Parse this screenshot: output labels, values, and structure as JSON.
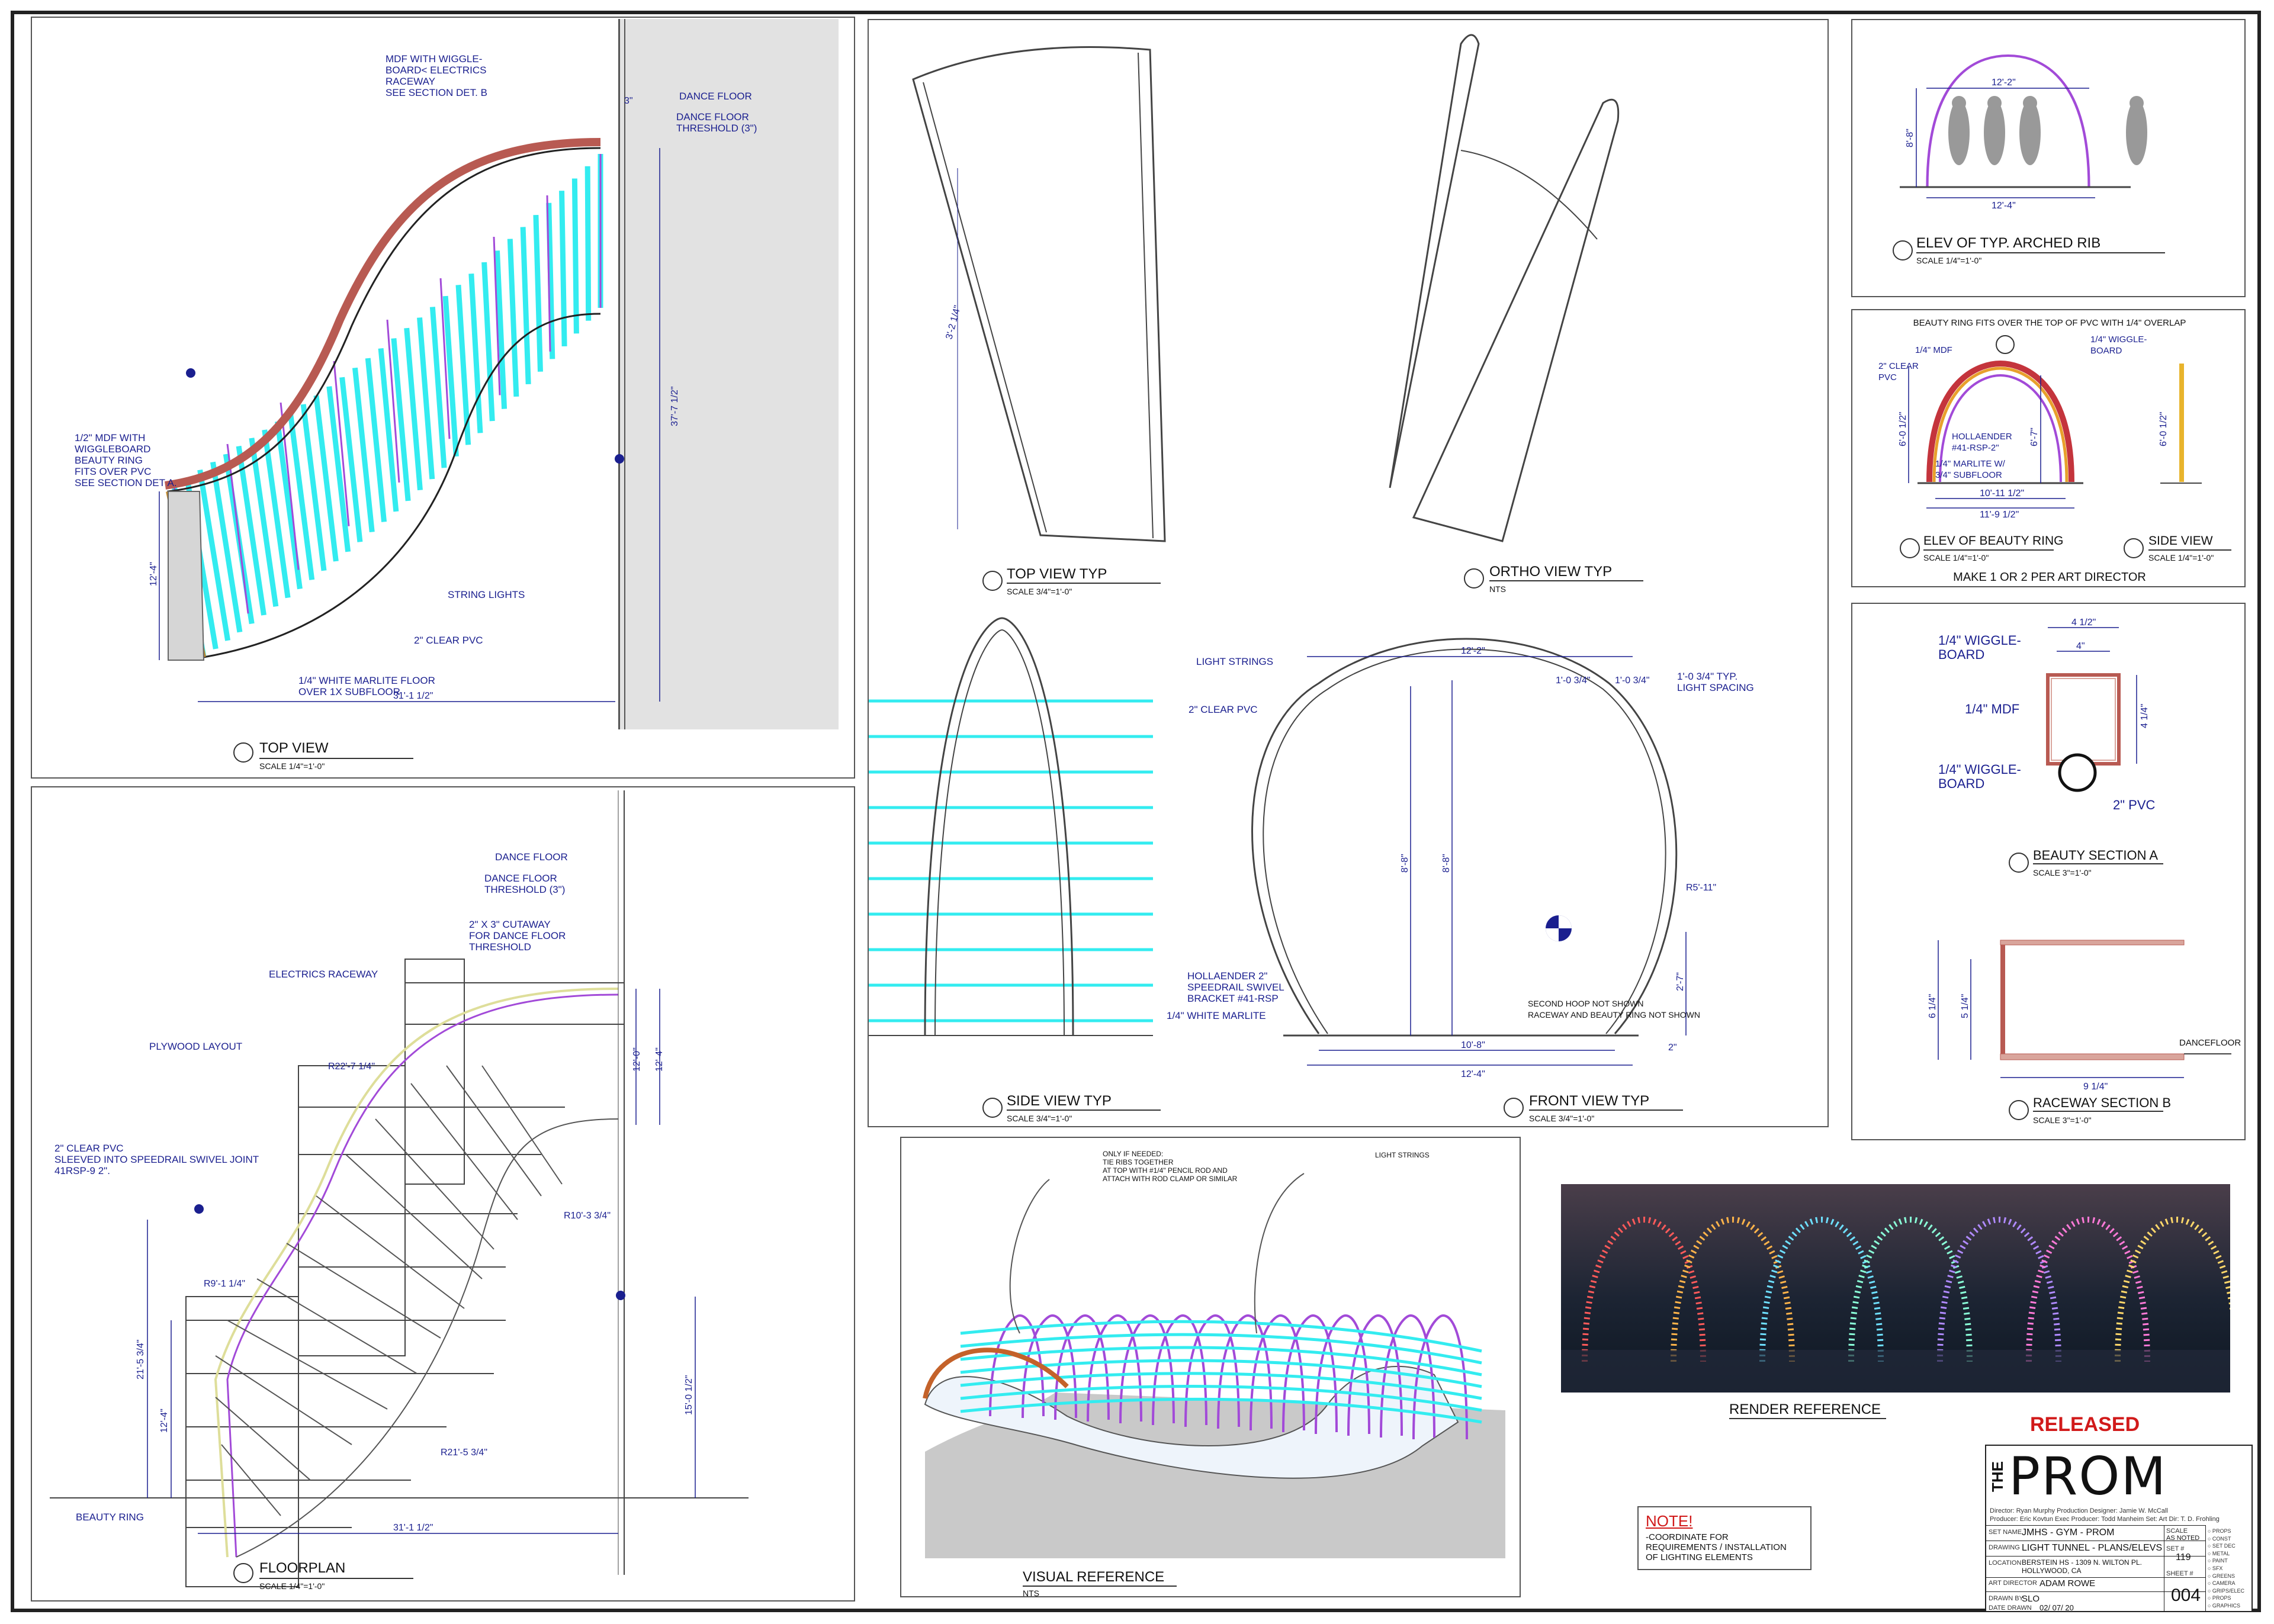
{
  "panels": {
    "top_view": {
      "title": "TOP VIEW",
      "scale": "SCALE 1/4\"=1'-0\"",
      "labels": {
        "mdf": "MDF WITH WIGGLE-\nBOARD< ELECTRICS\nRACEWAY\nSEE SECTION DET. B",
        "dance_floor": "DANCE FLOOR",
        "threshold": "DANCE FLOOR\nTHRESHOLD (3\")",
        "beauty_ring": "1/2\" MDF WITH\nWIGGLEBOARD\nBEAUTY RING\nFITS OVER PVC\nSEE SECTION DET A.",
        "string_lights": "STRING LIGHTS",
        "clear_pvc": "2\" CLEAR PVC",
        "marlite": "1/4\" WHITE MARLITE FLOOR\nOVER 1X SUBFLOOR"
      },
      "dims": {
        "overall": "31'-1 1/2\"",
        "height": "37'-7 1/2\"",
        "left": "12'-4\"",
        "three": "3\""
      }
    },
    "floorplan": {
      "title": "FLOORPLAN",
      "scale": "SCALE 1/4\"=1'-0\"",
      "labels": {
        "dance_floor": "DANCE FLOOR",
        "threshold": "DANCE FLOOR\nTHRESHOLD (3\")",
        "cutaway": "2\" X 3\" CUTAWAY\nFOR DANCE FLOOR\nTHRESHOLD",
        "raceway": "ELECTRICS RACEWAY",
        "plywood": "PLYWOOD LAYOUT",
        "pvc": "2\" CLEAR PVC\nSLEEVED INTO SPEEDRAIL SWIVEL JOINT\n41RSP-9 2\".",
        "beauty_ring": "BEAUTY RING"
      },
      "dims": {
        "r1": "R22'-7 1/4\"",
        "r2": "R10'-3 3/4\"",
        "r3": "R9'-1 1/4\"",
        "r4": "R21'-5 3/4\"",
        "overall": "31'-1 1/2\"",
        "h1": "12'-0\"",
        "h2": "12'-4\"",
        "h3": "21'-5 3/4\"",
        "h4": "12'-4\"",
        "h5": "15'-0 1/2\""
      }
    },
    "top_view_typ": {
      "title": "TOP VIEW TYP",
      "scale": "SCALE 3/4\"=1'-0\"",
      "dim": "3'-2 1/4\""
    },
    "ortho_view": {
      "title": "ORTHO VIEW TYP",
      "scale": "NTS"
    },
    "side_view_typ": {
      "title": "SIDE VIEW TYP",
      "scale": "SCALE 3/4\"=1'-0\"",
      "labels": {
        "light_strings": "LIGHT STRINGS",
        "pvc": "2\" CLEAR PVC",
        "holl": "HOLLAENDER 2\"\nSPEEDRAIL SWIVEL\nBRACKET #41-RSP",
        "marlite": "1/4\" WHITE MARLITE"
      }
    },
    "front_view_typ": {
      "title": "FRONT VIEW TYP",
      "scale": "SCALE 3/4\"=1'-0\"",
      "labels": {
        "spacing": "1'-0 3/4\" TYP.\nLIGHT SPACING",
        "radius": "R5'-11\"",
        "note": "SECOND HOOP NOT SHOWN\nRACEWAY AND BEAUTY RING NOT SHOWN"
      },
      "dims": {
        "top": "12'-2\"",
        "inner": "10'-8\"",
        "bottom": "12'-4\"",
        "h1": "8'-8\"",
        "h2": "8'-8\"",
        "h3": "2'-7\"",
        "s1": "1'-0 3/4\"",
        "s2": "1'-0 3/4\"",
        "two": "2\""
      }
    },
    "elev_rib": {
      "title": "ELEV OF TYP. ARCHED RIB",
      "scale": "SCALE 1/4\"=1'-0\"",
      "dims": {
        "top": "12'-2\"",
        "bottom": "12'-4\"",
        "h": "8'-8\""
      }
    },
    "beauty_ring": {
      "header": "BEAUTY RING FITS OVER THE TOP OF PVC WITH 1/4\" OVERLAP",
      "title": "ELEV OF BEAUTY RING",
      "scale": "SCALE 1/4\"=1'-0\"",
      "side_title": "SIDE VIEW",
      "side_scale": "SCALE 1/4\"=1'-0\"",
      "footer": "MAKE 1 OR 2 PER ART DIRECTOR",
      "labels": {
        "mdf": "1/4\" MDF",
        "pvc": "2\" CLEAR\nPVC",
        "holl": "HOLLAENDER\n#41-RSP-2\"",
        "marlite": "1/4\" MARLITE W/\n3/4\" SUBFLOOR",
        "wiggle": "1/4\" WIGGLE-\nBOARD"
      },
      "dims": {
        "inner": "10'-11 1/2\"",
        "outer": "11'-9 1/2\"",
        "h": "6'-7\"",
        "h2": "6'-0 1/2\"",
        "side_h": "6'-0 1/2\""
      }
    },
    "beauty_section": {
      "title": "BEAUTY SECTION A",
      "scale": "SCALE 3\"=1'-0\"",
      "labels": {
        "wiggle1": "1/4\" WIGGLE-\nBOARD",
        "mdf": "1/4\" MDF",
        "wiggle2": "1/4\" WIGGLE-\nBOARD",
        "pvc": "2\" PVC"
      },
      "dims": {
        "w1": "4 1/2\"",
        "w2": "4\"",
        "h": "4 1/4\""
      }
    },
    "raceway_section": {
      "title": "RACEWAY SECTION B",
      "scale": "SCALE 3\"=1'-0\"",
      "labels": {
        "dance_floor": "DANCEFLOOR"
      },
      "dims": {
        "w": "9 1/4\"",
        "h1": "6 1/4\"",
        "h2": "5 1/4\""
      }
    },
    "visual_reference": {
      "title": "VISUAL REFERENCE",
      "scale": "NTS",
      "labels": {
        "tie": "ONLY IF NEEDED:\nTIE RIBS TOGETHER\nAT TOP WITH #1/4\" PENCIL ROD AND\nATTACH WITH ROD CLAMP OR SIMILAR",
        "strings": "LIGHT STRINGS"
      }
    },
    "render_reference": {
      "title": "RENDER REFERENCE"
    },
    "note": {
      "heading": "NOTE!",
      "text": "-COORDINATE FOR\nREQUIREMENTS / INSTALLATION\nOF LIGHTING ELEMENTS"
    },
    "released": "RELEASED"
  },
  "title_block": {
    "logo_the": "THE",
    "logo_prom": "PROM",
    "credits1": "Director: Ryan Murphy    Production Designer: Jamie W. McCall",
    "credits2": "Producer: Eric Kovtun    Exec Producer: Todd Manheim    Set: Art Dir: T. D. Frohling",
    "set": "JMHS - GYM - PROM",
    "drawing": "LIGHT TUNNEL - PLANS/ELEVS",
    "location": "BERSTEIN HS - 1309 N. WILTON PL.\nHOLLYWOOD, CA",
    "art_director": "ADAM ROWE",
    "drawn_by": "SLO",
    "date": "02/ 07/ 20",
    "scale": "AS NOTED",
    "set_no": "119",
    "sheet_no": "004",
    "checklist": [
      "PROPS",
      "CONST",
      "SET DEC",
      "METAL",
      "PAINT",
      "SFX",
      "GREENS",
      "CAMERA",
      "GRIPS/ELEC",
      "PROPS",
      "GRAPHICS"
    ]
  },
  "colors": {
    "cyan": "#33ecf0",
    "magenta": "#a24ad8",
    "terracotta": "#b85a52",
    "blue": "#1a1f8f",
    "gray": "#e2e2e2"
  }
}
